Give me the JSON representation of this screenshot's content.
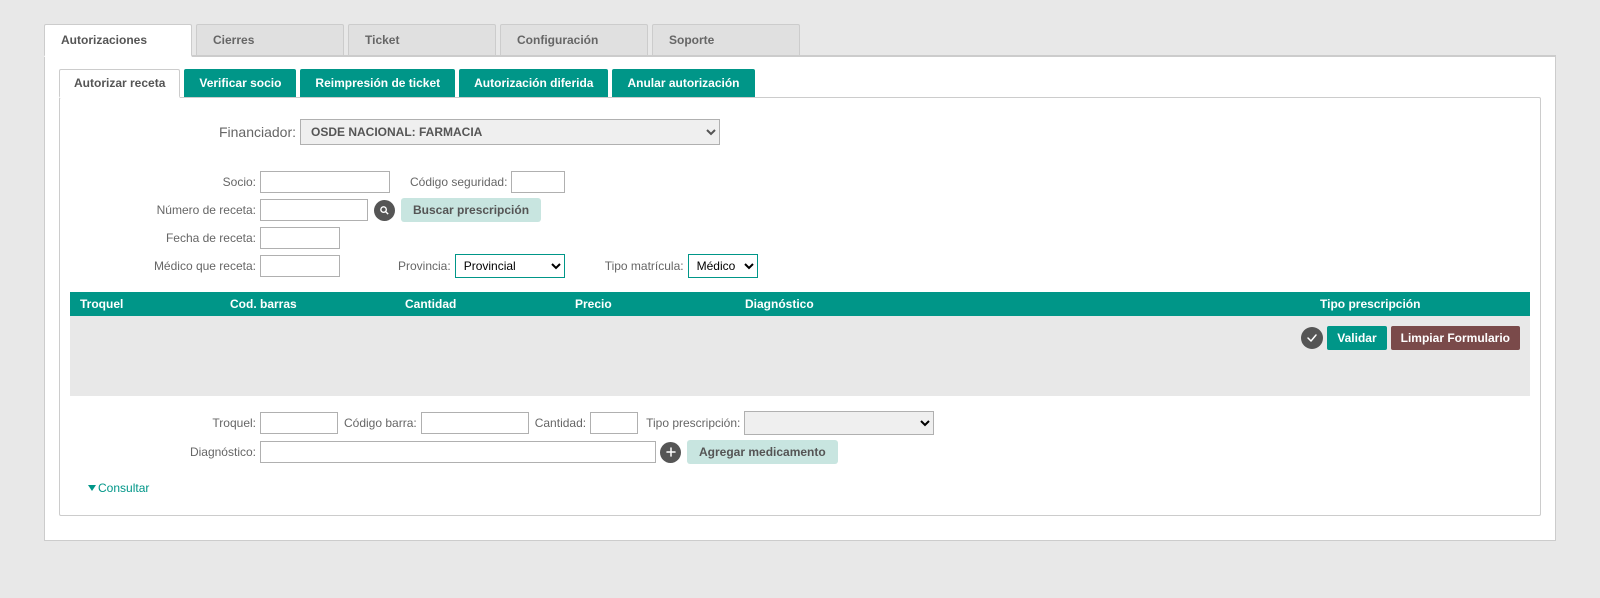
{
  "topTabs": {
    "autorizaciones": "Autorizaciones",
    "cierres": "Cierres",
    "ticket": "Ticket",
    "configuracion": "Configuración",
    "soporte": "Soporte"
  },
  "subTabs": {
    "autorizarReceta": "Autorizar receta",
    "verificarSocio": "Verificar socio",
    "reimpresion": "Reimpresión de ticket",
    "diferida": "Autorización diferida",
    "anular": "Anular autorización"
  },
  "form": {
    "financiadorLabel": "Financiador:",
    "financiadorValue": "OSDE NACIONAL: FARMACIA",
    "socioLabel": "Socio:",
    "codigoSeguridadLabel": "Código seguridad:",
    "numeroRecetaLabel": "Número de receta:",
    "buscarPrescripcion": "Buscar prescripción",
    "fechaRecetaLabel": "Fecha de receta:",
    "medicoRecetaLabel": "Médico que receta:",
    "provinciaLabel": "Provincia:",
    "provinciaValue": "Provincial",
    "tipoMatriculaLabel": "Tipo matrícula:",
    "tipoMatriculaValue": "Médico"
  },
  "tableHeaders": {
    "troquel": "Troquel",
    "codBarras": "Cod. barras",
    "cantidad": "Cantidad",
    "precio": "Precio",
    "diagnostico": "Diagnóstico",
    "tipoPrescripcion": "Tipo prescripción"
  },
  "actions": {
    "validar": "Validar",
    "limpiar": "Limpiar Formulario"
  },
  "med": {
    "troquelLabel": "Troquel:",
    "codigoBarraLabel": "Código barra:",
    "cantidadLabel": "Cantidad:",
    "tipoPrescLabel": "Tipo prescripción:",
    "diagnosticoLabel": "Diagnóstico:",
    "agregar": "Agregar medicamento",
    "consultar": "Consultar"
  }
}
